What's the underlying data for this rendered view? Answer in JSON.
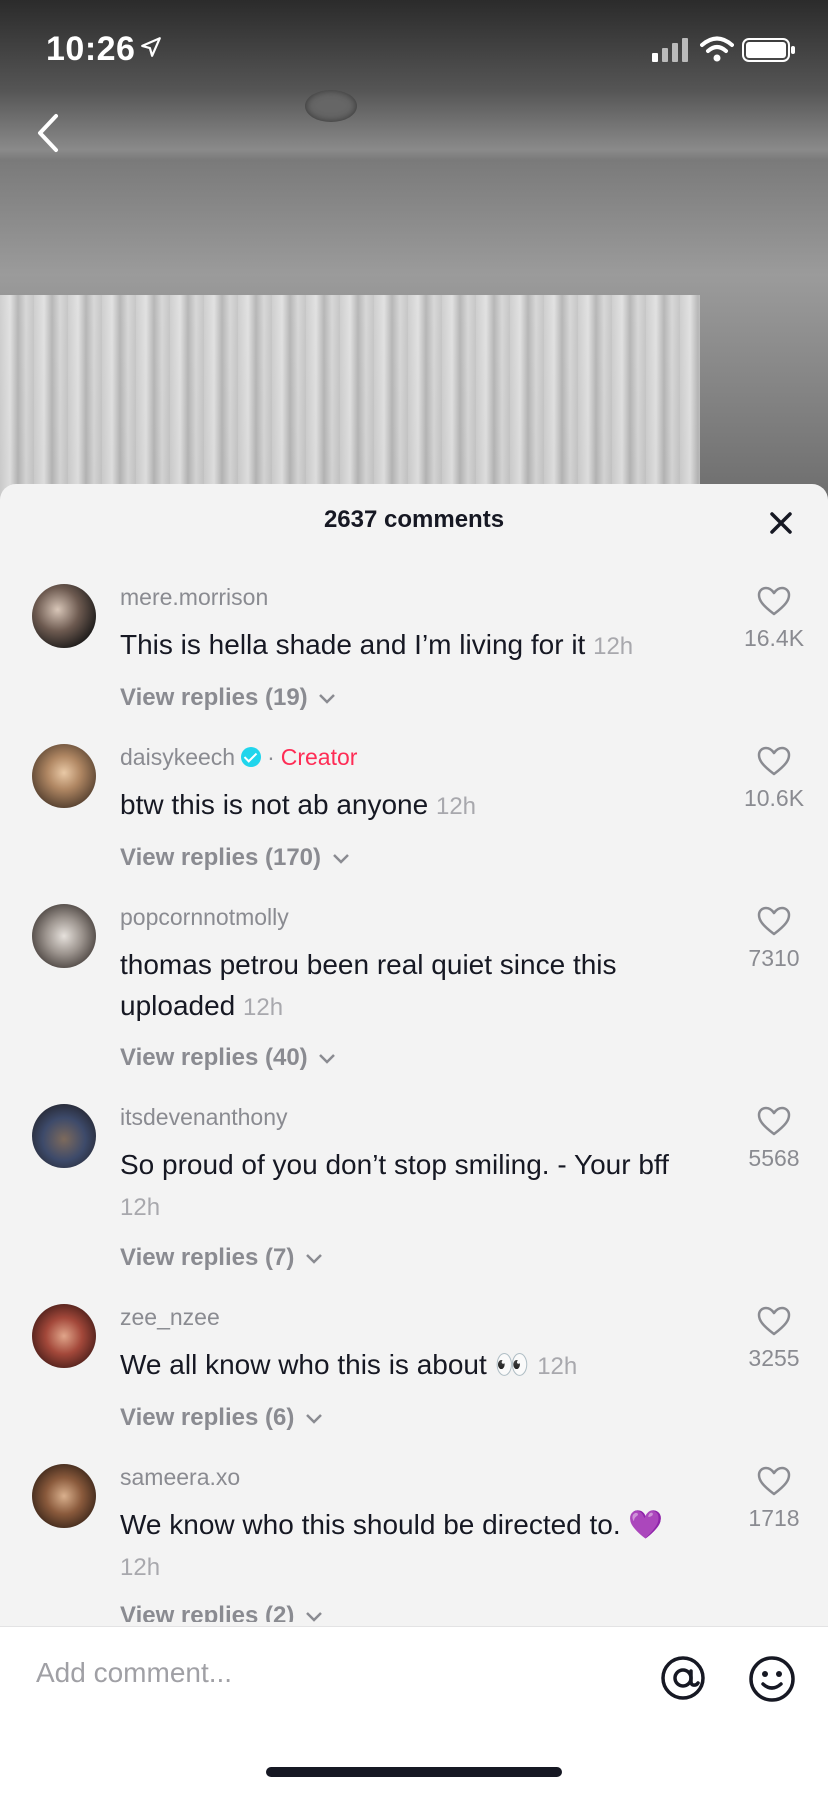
{
  "status_bar": {
    "time": "10:26"
  },
  "sheet": {
    "title": "2637 comments"
  },
  "comments": [
    {
      "username": "mere.morrison",
      "text": "This is hella shade and I’m living for it",
      "time": "12h",
      "replies": "View replies (19)",
      "likes": "16.4K"
    },
    {
      "username": "daisykeech",
      "badge": "Creator",
      "text": "btw this is not ab anyone",
      "time": "12h",
      "replies": "View replies (170)",
      "likes": "10.6K"
    },
    {
      "username": "popcornnotmolly",
      "text": "thomas petrou been real quiet since this uploaded",
      "time": "12h",
      "replies": "View replies (40)",
      "likes": "7310"
    },
    {
      "username": "itsdevenanthony",
      "text": "So proud of you don’t stop smiling. - Your bff",
      "time": "12h",
      "replies": "View replies (7)",
      "likes": "5568"
    },
    {
      "username": "zee_nzee",
      "text": "We all know who this is about 👀",
      "time": "12h",
      "replies": "View replies (6)",
      "likes": "3255"
    },
    {
      "username": "sameera.xo",
      "text": "We know who this should be directed to. 💜",
      "time": "12h",
      "replies": "View replies (2)",
      "likes": "1718"
    }
  ],
  "input": {
    "placeholder": "Add comment..."
  },
  "icons": {
    "back": "chevron-left-icon",
    "close": "close-icon",
    "like": "heart-icon",
    "mention": "at-sign-icon",
    "emoji": "emoji-icon"
  },
  "colors": {
    "creator": "#fe2c55",
    "verified": "#20d5ec"
  }
}
